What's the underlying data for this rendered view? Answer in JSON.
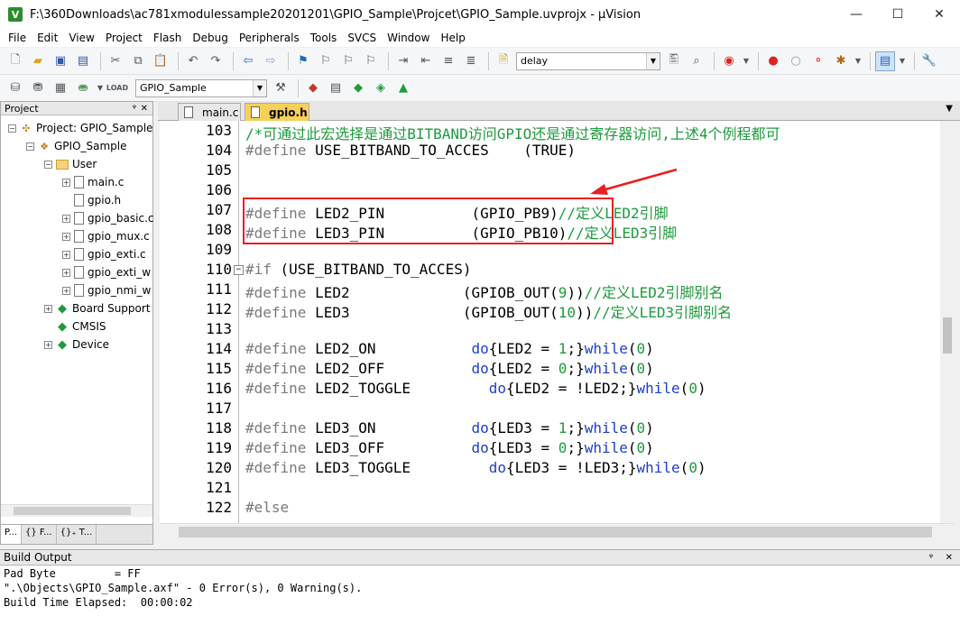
{
  "window": {
    "title": "F:\\360Downloads\\ac781xmodulessample20201201\\GPIO_Sample\\Projcet\\GPIO_Sample.uvprojx - µVision",
    "min": "—",
    "max": "☐",
    "close": "✕"
  },
  "menu": [
    "File",
    "Edit",
    "View",
    "Project",
    "Flash",
    "Debug",
    "Peripherals",
    "Tools",
    "SVCS",
    "Window",
    "Help"
  ],
  "toolbar": {
    "find_value": "delay",
    "target_value": "GPIO_Sample"
  },
  "project_panel": {
    "title": "Project",
    "pin": "ᵠ",
    "close": "✕",
    "tree": [
      {
        "label": "Project: GPIO_Sample",
        "level": 0,
        "icon": "project-icon",
        "exp": "−"
      },
      {
        "label": "GPIO_Sample",
        "level": 1,
        "icon": "target-icon",
        "exp": "−"
      },
      {
        "label": "User",
        "level": 2,
        "icon": "folder-icon",
        "exp": "−"
      },
      {
        "label": "main.c",
        "level": 3,
        "icon": "file-icon",
        "exp": "+"
      },
      {
        "label": "gpio.h",
        "level": 3,
        "icon": "file-icon",
        "exp": ""
      },
      {
        "label": "gpio_basic.c",
        "level": 3,
        "icon": "file-icon",
        "exp": "+"
      },
      {
        "label": "gpio_mux.c",
        "level": 3,
        "icon": "file-icon",
        "exp": "+"
      },
      {
        "label": "gpio_exti.c",
        "level": 3,
        "icon": "file-icon",
        "exp": "+"
      },
      {
        "label": "gpio_exti_w",
        "level": 3,
        "icon": "file-icon",
        "exp": "+"
      },
      {
        "label": "gpio_nmi_w",
        "level": 3,
        "icon": "file-icon",
        "exp": "+"
      },
      {
        "label": "Board Support",
        "level": 2,
        "icon": "green-diamond-icon",
        "exp": "+"
      },
      {
        "label": "CMSIS",
        "level": 2,
        "icon": "green-diamond-icon",
        "exp": ""
      },
      {
        "label": "Device",
        "level": 2,
        "icon": "green-diamond-icon",
        "exp": "+"
      }
    ],
    "bottom_tabs": [
      "P...",
      "{} F...",
      "{}₊ T..."
    ]
  },
  "editor": {
    "tabs": [
      {
        "label": "main.c",
        "active": false
      },
      {
        "label": "gpio.h",
        "active": true
      }
    ],
    "lines": [
      {
        "n": "103",
        "fold": "",
        "parts": [
          {
            "t": "/*可通过此宏选择是通过BITBAND访问GPIO还是通过寄存器访问,上述4个例程都可",
            "c": "cm"
          }
        ]
      },
      {
        "n": "104",
        "fold": "",
        "parts": [
          {
            "t": "#define",
            "c": "kw"
          },
          {
            "t": " USE_BITBAND_TO_ACCES    (TRUE)",
            "c": ""
          }
        ]
      },
      {
        "n": "105",
        "fold": "",
        "parts": []
      },
      {
        "n": "106",
        "fold": "",
        "parts": []
      },
      {
        "n": "107",
        "fold": "",
        "parts": [
          {
            "t": "#define",
            "c": "kw"
          },
          {
            "t": " LED2_PIN          (GPIO_PB9)",
            "c": ""
          },
          {
            "t": "//定义LED2引脚",
            "c": "cm"
          }
        ]
      },
      {
        "n": "108",
        "fold": "",
        "parts": [
          {
            "t": "#define",
            "c": "kw"
          },
          {
            "t": " LED3_PIN          (GPIO_PB10)",
            "c": ""
          },
          {
            "t": "//定义LED3引脚",
            "c": "cm"
          }
        ]
      },
      {
        "n": "109",
        "fold": "",
        "parts": []
      },
      {
        "n": "110",
        "fold": "−",
        "parts": [
          {
            "t": "#if",
            "c": "kw"
          },
          {
            "t": " (USE_BITBAND_TO_ACCES)",
            "c": ""
          }
        ]
      },
      {
        "n": "111",
        "fold": "",
        "parts": [
          {
            "t": "#define",
            "c": "kw"
          },
          {
            "t": " LED2             (GPIOB_OUT(",
            "c": ""
          },
          {
            "t": "9",
            "c": "cm"
          },
          {
            "t": "))",
            "c": ""
          },
          {
            "t": "//定义LED2引脚别名",
            "c": "cm"
          }
        ]
      },
      {
        "n": "112",
        "fold": "",
        "parts": [
          {
            "t": "#define",
            "c": "kw"
          },
          {
            "t": " LED3             (GPIOB_OUT(",
            "c": ""
          },
          {
            "t": "10",
            "c": "cm"
          },
          {
            "t": "))",
            "c": ""
          },
          {
            "t": "//定义LED3引脚别名",
            "c": "cm"
          }
        ]
      },
      {
        "n": "113",
        "fold": "",
        "parts": []
      },
      {
        "n": "114",
        "fold": "",
        "parts": [
          {
            "t": "#define",
            "c": "kw"
          },
          {
            "t": " LED2_ON           ",
            "c": ""
          },
          {
            "t": "do",
            "c": "bl"
          },
          {
            "t": "{LED2 = ",
            "c": ""
          },
          {
            "t": "1",
            "c": "cm"
          },
          {
            "t": ";}",
            "c": ""
          },
          {
            "t": "while",
            "c": "bl"
          },
          {
            "t": "(",
            "c": ""
          },
          {
            "t": "0",
            "c": "cm"
          },
          {
            "t": ")",
            "c": ""
          }
        ]
      },
      {
        "n": "115",
        "fold": "",
        "parts": [
          {
            "t": "#define",
            "c": "kw"
          },
          {
            "t": " LED2_OFF          ",
            "c": ""
          },
          {
            "t": "do",
            "c": "bl"
          },
          {
            "t": "{LED2 = ",
            "c": ""
          },
          {
            "t": "0",
            "c": "cm"
          },
          {
            "t": ";}",
            "c": ""
          },
          {
            "t": "while",
            "c": "bl"
          },
          {
            "t": "(",
            "c": ""
          },
          {
            "t": "0",
            "c": "cm"
          },
          {
            "t": ")",
            "c": ""
          }
        ]
      },
      {
        "n": "116",
        "fold": "",
        "parts": [
          {
            "t": "#define",
            "c": "kw"
          },
          {
            "t": " LED2_TOGGLE         ",
            "c": ""
          },
          {
            "t": "do",
            "c": "bl"
          },
          {
            "t": "{LED2 = !LED2;}",
            "c": ""
          },
          {
            "t": "while",
            "c": "bl"
          },
          {
            "t": "(",
            "c": ""
          },
          {
            "t": "0",
            "c": "cm"
          },
          {
            "t": ")",
            "c": ""
          }
        ]
      },
      {
        "n": "117",
        "fold": "",
        "parts": []
      },
      {
        "n": "118",
        "fold": "",
        "parts": [
          {
            "t": "#define",
            "c": "kw"
          },
          {
            "t": " LED3_ON           ",
            "c": ""
          },
          {
            "t": "do",
            "c": "bl"
          },
          {
            "t": "{LED3 = ",
            "c": ""
          },
          {
            "t": "1",
            "c": "cm"
          },
          {
            "t": ";}",
            "c": ""
          },
          {
            "t": "while",
            "c": "bl"
          },
          {
            "t": "(",
            "c": ""
          },
          {
            "t": "0",
            "c": "cm"
          },
          {
            "t": ")",
            "c": ""
          }
        ]
      },
      {
        "n": "119",
        "fold": "",
        "parts": [
          {
            "t": "#define",
            "c": "kw"
          },
          {
            "t": " LED3_OFF          ",
            "c": ""
          },
          {
            "t": "do",
            "c": "bl"
          },
          {
            "t": "{LED3 = ",
            "c": ""
          },
          {
            "t": "0",
            "c": "cm"
          },
          {
            "t": ";}",
            "c": ""
          },
          {
            "t": "while",
            "c": "bl"
          },
          {
            "t": "(",
            "c": ""
          },
          {
            "t": "0",
            "c": "cm"
          },
          {
            "t": ")",
            "c": ""
          }
        ]
      },
      {
        "n": "120",
        "fold": "",
        "parts": [
          {
            "t": "#define",
            "c": "kw"
          },
          {
            "t": " LED3_TOGGLE         ",
            "c": ""
          },
          {
            "t": "do",
            "c": "bl"
          },
          {
            "t": "{LED3 = !LED3;}",
            "c": ""
          },
          {
            "t": "while",
            "c": "bl"
          },
          {
            "t": "(",
            "c": ""
          },
          {
            "t": "0",
            "c": "cm"
          },
          {
            "t": ")",
            "c": ""
          }
        ]
      },
      {
        "n": "121",
        "fold": "",
        "parts": []
      },
      {
        "n": "122",
        "fold": "",
        "parts": [
          {
            "t": "#else",
            "c": "kw"
          }
        ]
      }
    ]
  },
  "build_output": {
    "title": "Build Output",
    "lines": [
      "Pad Byte         = FF",
      "\".\\Objects\\GPIO_Sample.axf\" - 0 Error(s), 0 Warning(s).",
      "Build Time Elapsed:  00:00:02"
    ]
  },
  "colors": {
    "comment": "#1d9a3c",
    "keyword": "#7a7a7a",
    "blue": "#1a3fc8",
    "highlight_box": "#e82020",
    "active_tab": "#f7d05a"
  }
}
